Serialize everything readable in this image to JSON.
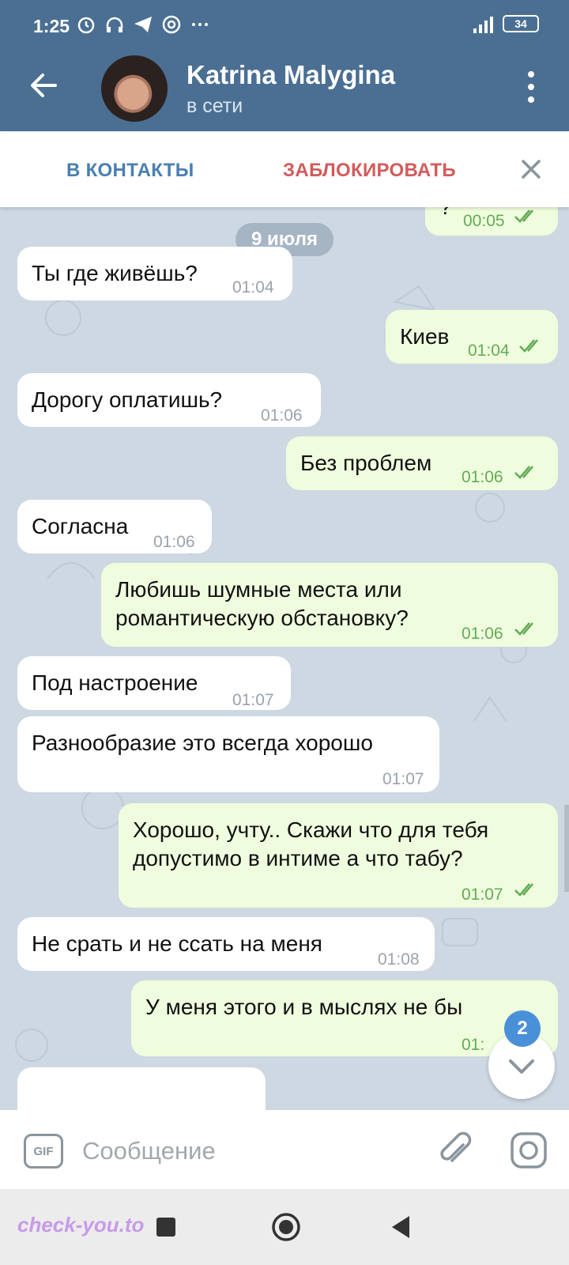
{
  "status": {
    "time": "1:25",
    "network": "4G",
    "battery": "34"
  },
  "header": {
    "title": "Katrina Malygina",
    "subtitle": "в сети"
  },
  "actions": {
    "add_contact": "В КОНТАКТЫ",
    "block": "ЗАБЛОКИРОВАТЬ"
  },
  "chat": {
    "date": "9 июля",
    "partial_top": {
      "text": "?",
      "time": "00:05"
    },
    "messages": [
      {
        "text": "Ты где живёшь?",
        "time": "01:04"
      },
      {
        "text": "Киев",
        "time": "01:04"
      },
      {
        "text": "Дорогу оплатишь?",
        "time": "01:06"
      },
      {
        "text": "Без проблем",
        "time": "01:06"
      },
      {
        "text": "Согласна",
        "time": "01:06"
      },
      {
        "line1": "Любишь шумные места или",
        "line2": "романтическую обстановку?",
        "time": "01:06"
      },
      {
        "text": "Под настроение",
        "time": "01:07"
      },
      {
        "text": "Разнообразие это всегда хорошо",
        "time": "01:07"
      },
      {
        "line1": "Хорошо, учту.. Скажи что для тебя",
        "line2": "допустимо в интиме а что табу?",
        "time": "01:07"
      },
      {
        "text": "Не срать и не ссать на меня",
        "time": "01:08"
      },
      {
        "text": "У меня этого и в мыслях не бы",
        "time": "01:"
      }
    ],
    "unread_count": "2"
  },
  "input": {
    "gif_label": "GIF",
    "placeholder": "Сообщение"
  },
  "watermark": "check-you.to",
  "colors": {
    "header": "#4a6f93",
    "outgoing": "#effdde",
    "incoming": "#ffffff",
    "accent": "#4a7eb3",
    "danger": "#d35b5b"
  }
}
